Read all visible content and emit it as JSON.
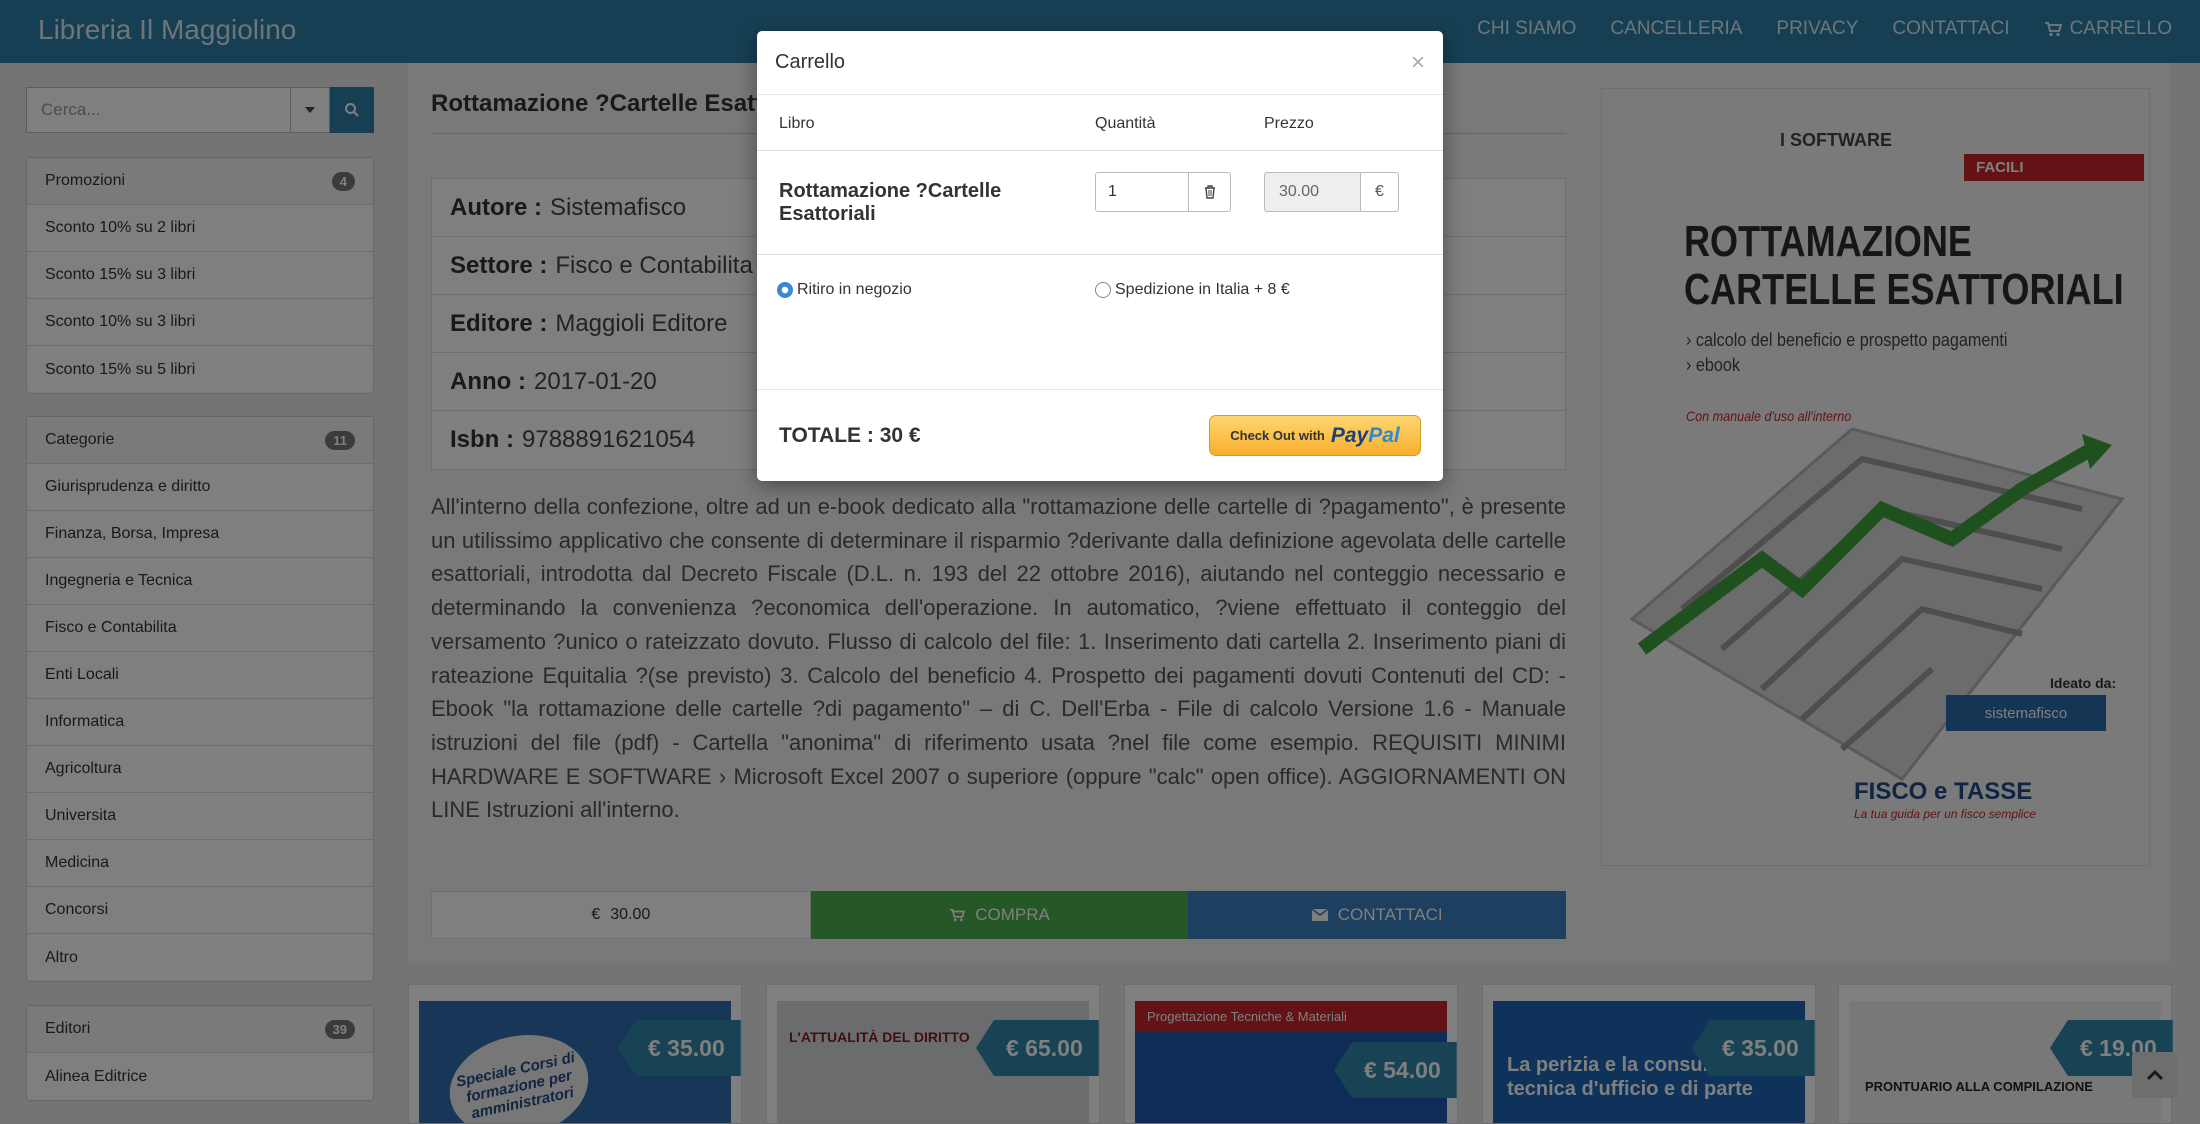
{
  "navbar": {
    "brand": "Libreria Il Maggiolino",
    "links": [
      "CHI SIAMO",
      "CANCELLERIA",
      "PRIVACY",
      "CONTATTACI"
    ],
    "cart_label": "CARRELLO"
  },
  "sidebar": {
    "search_placeholder": "Cerca...",
    "promozioni": {
      "title": "Promozioni",
      "count": "4",
      "items": [
        "Sconto 10% su 2 libri",
        "Sconto 15% su 3 libri",
        "Sconto 10% su 3 libri",
        "Sconto 15% su 5 libri"
      ]
    },
    "categorie": {
      "title": "Categorie",
      "count": "11",
      "items": [
        "Giurisprudenza e diritto",
        "Finanza, Borsa, Impresa",
        "Ingegneria e Tecnica",
        "Fisco e Contabilita",
        "Enti Locali",
        "Informatica",
        "Agricoltura",
        "Universita",
        "Medicina",
        "Concorsi",
        "Altro"
      ]
    },
    "editori": {
      "title": "Editori",
      "count": "39",
      "items": [
        "Alinea Editrice"
      ]
    }
  },
  "book": {
    "title": "Rottamazione ?Cartelle Esattoriali",
    "info": [
      {
        "label": "Autore :",
        "value": "Sistemafisco"
      },
      {
        "label": "Settore :",
        "value": "Fisco e Contabilita"
      },
      {
        "label": "Editore :",
        "value": "Maggioli Editore"
      },
      {
        "label": "Anno :",
        "value": "2017-01-20"
      },
      {
        "label": "Isbn :",
        "value": "9788891621054"
      }
    ],
    "description": "All'interno della confezione, oltre ad un e-book dedicato alla \"rottamazione delle cartelle di ?pagamento\", è presente un utilissimo applicativo che consente di determinare il risparmio ?derivante dalla definizione agevolata delle cartelle esattoriali, introdotta dal Decreto Fiscale (D.L. n. 193 del 22 ottobre 2016), aiutando nel conteggio necessario e determinando la convenienza ?economica dell'operazione. In automatico, ?viene effettuato il conteggio del versamento ?unico o rateizzato dovuto. Flusso di calcolo del file: 1. Inserimento dati cartella 2. Inserimento piani di rateazione Equitalia ?(se previsto) 3. Calcolo del beneficio 4. Prospetto dei pagamenti dovuti Contenuti del CD: - Ebook \"la rottamazione delle cartelle ?di pagamento\" – di C. Dell'Erba - File di calcolo Versione 1.6 - Manuale istruzioni del file (pdf) - Cartella \"anonima\" di riferimento usata ?nel file come esempio. REQUISITI MINIMI HARDWARE E SOFTWARE › Microsoft Excel 2007 o superiore (oppure \"calc\" open office). AGGIORNAMENTI ON LINE Istruzioni all'interno.",
    "price_currency": "€",
    "price": "30.00",
    "buy_label": "COMPRA",
    "contact_label": "CONTATTACI"
  },
  "cover": {
    "series": "I SOFTWARE",
    "tag": "FACILI",
    "title_line1": "ROTTAMAZIONE",
    "title_line2": "CARTELLE ESATTORIALI",
    "bullet1": "› calcolo del beneficio e prospetto pagamenti",
    "bullet2": "› ebook",
    "note": "Con manuale d'uso all'interno",
    "ideato": "Ideato da:",
    "sistema": "sistemafisco",
    "fisco": "FISCO e TASSE",
    "fisco_sub": "La tua guida per un fisco semplice"
  },
  "cards": [
    {
      "price": "€ 35.00",
      "caption": "Speciale Corsi di formazione per amministratori"
    },
    {
      "price": "€ 65.00",
      "caption": "L'ATTUALITÀ DEL DIRITTO"
    },
    {
      "price": "€ 54.00",
      "caption": "Progettazione Tecniche & Materiali"
    },
    {
      "price": "€ 35.00",
      "caption": "La perizia e la consulenza tecnica d'ufficio e di parte"
    },
    {
      "price": "€ 19.00",
      "caption": "PRONTUARIO ALLA COMPILAZIONE"
    }
  ],
  "modal": {
    "title": "Carrello",
    "close": "×",
    "headers": {
      "book": "Libro",
      "qty": "Quantità",
      "price": "Prezzo"
    },
    "row": {
      "book": "Rottamazione ?Cartelle Esattoriali",
      "qty": "1",
      "price": "30.00",
      "currency": "€"
    },
    "shipping": {
      "pickup": "Ritiro in negozio",
      "delivery": "Spedizione in Italia + 8 €",
      "selected": "pickup"
    },
    "total": "TOTALE : 30 €",
    "paypal_prefix": "Check Out with",
    "paypal_logo_a": "Pay",
    "paypal_logo_b": "Pal"
  },
  "colors": {
    "navbar": "#2f7fa6",
    "buy": "#4cae4c",
    "contact": "#3b7ec0",
    "price_tag": "#2e86ab",
    "paypal": "#f7ae2d"
  }
}
